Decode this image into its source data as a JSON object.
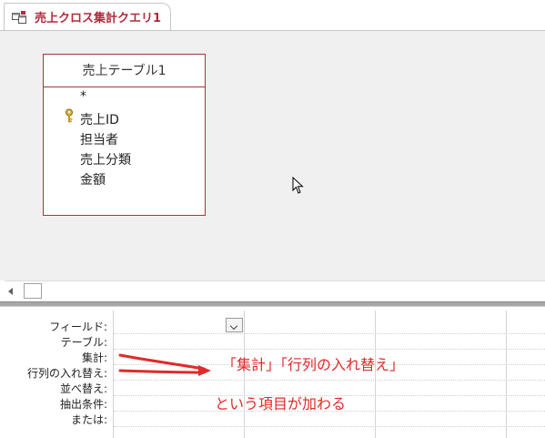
{
  "tab": {
    "title": "売上クロス集計クエリ1",
    "icon": "query-icon"
  },
  "table": {
    "title": "売上テーブル1",
    "fields": [
      "*",
      "売上ID",
      "担当者",
      "売上分類",
      "金額"
    ],
    "primary_key": "売上ID"
  },
  "grid": {
    "row_labels": [
      "フィールド:",
      "テーブル:",
      "集計:",
      "行列の入れ替え:",
      "並べ替え:",
      "抽出条件:",
      "または:"
    ]
  },
  "annotation": {
    "line1": "「集計」「行列の入れ替え」",
    "line2": "という項目が加わる",
    "color": "#e02a2a"
  },
  "colors": {
    "accent": "#b12b3d",
    "table_border": "#a4373a",
    "design_bg": "#f0f0f0"
  }
}
